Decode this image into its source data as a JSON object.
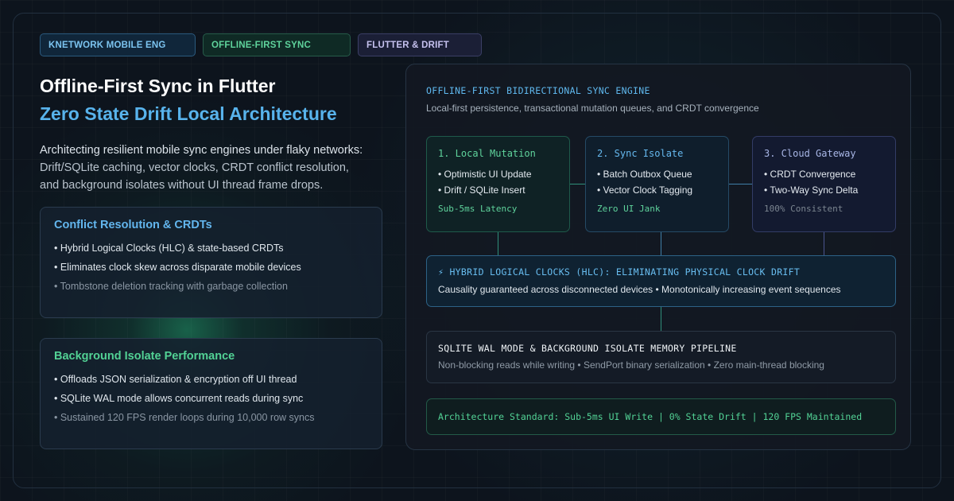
{
  "tags": [
    "KNETWORK MOBILE ENG",
    "OFFLINE-FIRST SYNC",
    "FLUTTER & DRIFT"
  ],
  "hero": {
    "title": "Offline-First Sync in Flutter",
    "subtitle": "Zero State Drift Local Architecture",
    "description_lines": [
      "Architecting resilient mobile sync engines under flaky networks:",
      "Drift/SQLite caching, vector clocks, CRDT conflict resolution,",
      "and background isolates without UI thread frame drops."
    ]
  },
  "cards": [
    {
      "title": "Conflict Resolution & CRDTs",
      "items": [
        "• Hybrid Logical Clocks (HLC) & state-based CRDTs",
        "• Eliminates clock skew across disparate mobile devices",
        "• Tombstone deletion tracking with garbage collection"
      ]
    },
    {
      "title": "Background Isolate Performance",
      "items": [
        "• Offloads JSON serialization & encryption off UI thread",
        "• SQLite WAL mode allows concurrent reads during sync",
        "• Sustained 120 FPS render loops during 10,000 row syncs"
      ]
    }
  ],
  "panel": {
    "title": "OFFLINE-FIRST BIDIRECTIONAL SYNC ENGINE",
    "subtitle": "Local-first persistence, transactional mutation queues, and CRDT convergence",
    "steps": [
      {
        "title": "1. Local Mutation",
        "items": [
          "• Optimistic UI Update",
          "• Drift / SQLite Insert"
        ],
        "footer": "Sub-5ms Latency"
      },
      {
        "title": "2. Sync Isolate",
        "items": [
          "• Batch Outbox Queue",
          "• Vector Clock Tagging"
        ],
        "footer": "Zero UI Jank"
      },
      {
        "title": "3. Cloud Gateway",
        "items": [
          "• CRDT Convergence",
          "• Two-Way Sync Delta"
        ],
        "footer": "100% Consistent"
      }
    ],
    "hlc": {
      "icon": "lightning-icon",
      "title": "⚡ HYBRID LOGICAL CLOCKS (HLC): ELIMINATING PHYSICAL CLOCK DRIFT",
      "description": "Causality guaranteed across disconnected devices • Monotonically increasing event sequences"
    },
    "sqlite": {
      "title": "SQLITE WAL MODE & BACKGROUND ISOLATE MEMORY PIPELINE",
      "description": "Non-blocking reads while writing • SendPort binary serialization • Zero main-thread blocking"
    },
    "standard": "Architecture Standard: Sub-5ms UI Write | 0% State Drift | 120 FPS Maintained"
  },
  "colors": {
    "background": "#0d141d",
    "accent_blue": "#58b3ec",
    "accent_green": "#52d295",
    "accent_purple": "#c5c1ee"
  }
}
